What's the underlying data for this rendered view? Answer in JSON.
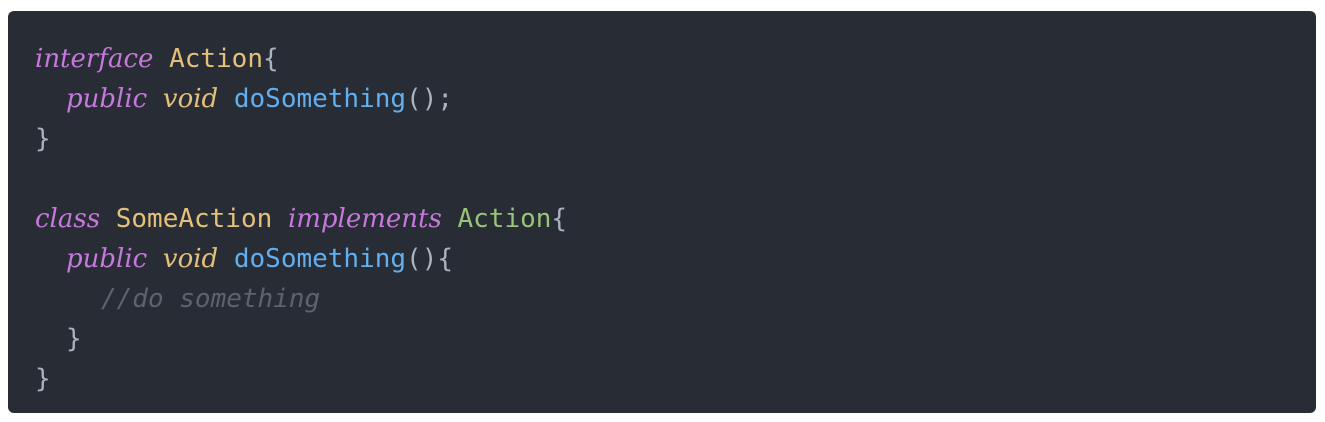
{
  "code": {
    "line1": {
      "keyword": "interface",
      "class_name": "Action",
      "brace": "{"
    },
    "line2": {
      "modifier": "public",
      "type": "void",
      "method": "doSomething",
      "punct": "();"
    },
    "line3": {
      "brace": "}"
    },
    "line5": {
      "keyword": "class",
      "class_name": "SomeAction",
      "implements": "implements",
      "interface_name": "Action",
      "brace": "{"
    },
    "line6": {
      "modifier": "public",
      "type": "void",
      "method": "doSomething",
      "punct": "(){"
    },
    "line7": {
      "comment": "//do something"
    },
    "line8": {
      "brace": "}"
    },
    "line9": {
      "brace": "}"
    }
  },
  "colors": {
    "background": "#282c34",
    "keyword": "#c678dd",
    "type": "#e5c07b",
    "function": "#61afef",
    "interface_ref": "#98c379",
    "comment": "#5c6370",
    "punctuation": "#abb2bf"
  }
}
